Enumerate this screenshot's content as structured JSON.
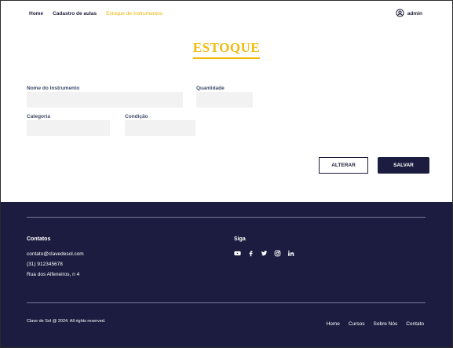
{
  "nav": {
    "items": [
      {
        "label": "Home"
      },
      {
        "label": "Cadastro de aulas"
      },
      {
        "label": "Estoque de instrumentos"
      }
    ],
    "active_index": 2,
    "user": "admin"
  },
  "page": {
    "title": "ESTOQUE"
  },
  "form": {
    "instrument_label": "Nome do Instrumento",
    "instrument_value": "",
    "quantity_label": "Quantidade",
    "quantity_value": "",
    "category_label": "Categoria",
    "category_value": "",
    "condition_label": "Condição",
    "condition_value": ""
  },
  "buttons": {
    "alterar": "ALTERAR",
    "salvar": "SALVAR"
  },
  "footer": {
    "contacts_title": "Contatos",
    "email": "contato@clavedesol.com",
    "phone": "(31) 912345678",
    "address": "Rua dos Alfeneiros, n 4",
    "social_title": "Siga",
    "social_icons": [
      "youtube-icon",
      "facebook-icon",
      "twitter-icon",
      "instagram-icon",
      "linkedin-icon"
    ],
    "copyright": "Clave de Sol @ 2024. All rights reserved.",
    "links": [
      {
        "label": "Home"
      },
      {
        "label": "Cursos"
      },
      {
        "label": "Sobre Nós"
      },
      {
        "label": "Contato"
      }
    ]
  },
  "colors": {
    "accent": "#f0bb0c",
    "navy": "#1c1c40",
    "field_bg": "#f2f2f2"
  }
}
